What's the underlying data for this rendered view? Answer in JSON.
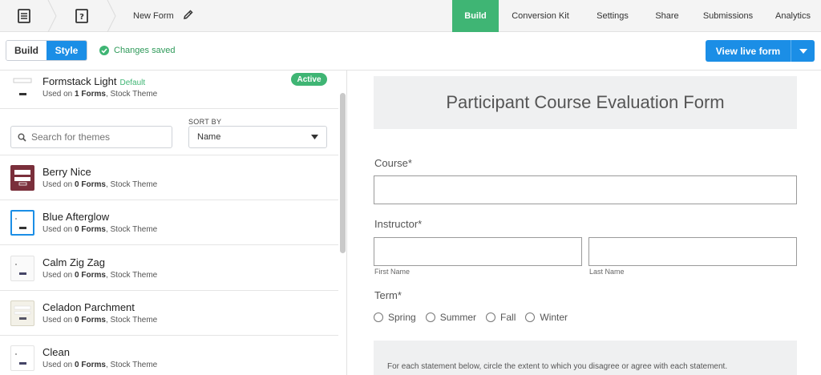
{
  "topbar": {
    "form_name": "New Form",
    "tabs": [
      {
        "label": "Build",
        "active": true
      },
      {
        "label": "Conversion Kit",
        "active": false
      },
      {
        "label": "Settings",
        "active": false
      },
      {
        "label": "Share",
        "active": false
      },
      {
        "label": "Submissions",
        "active": false
      },
      {
        "label": "Analytics",
        "active": false
      }
    ]
  },
  "subbar": {
    "toggle": {
      "build": "Build",
      "style": "Style",
      "selected": "Style"
    },
    "status": "Changes saved",
    "view_live": "View live form"
  },
  "themes_panel": {
    "current": {
      "name": "Formstack Light",
      "default_tag": "Default",
      "meta_prefix": "Used on ",
      "meta_count": "1 Forms",
      "meta_suffix": ", Stock Theme",
      "badge": "Active"
    },
    "search_placeholder": "Search for themes",
    "sort_by_label": "SORT BY",
    "sort_value": "Name",
    "items": [
      {
        "name": "Berry Nice",
        "meta_prefix": "Used on ",
        "meta_count": "0 Forms",
        "meta_suffix": ", Stock Theme"
      },
      {
        "name": "Blue Afterglow",
        "meta_prefix": "Used on ",
        "meta_count": "0 Forms",
        "meta_suffix": ", Stock Theme"
      },
      {
        "name": "Calm Zig Zag",
        "meta_prefix": "Used on ",
        "meta_count": "0 Forms",
        "meta_suffix": ", Stock Theme"
      },
      {
        "name": "Celadon Parchment",
        "meta_prefix": "Used on ",
        "meta_count": "0 Forms",
        "meta_suffix": ", Stock Theme"
      },
      {
        "name": "Clean",
        "meta_prefix": "Used on ",
        "meta_count": "0 Forms",
        "meta_suffix": ", Stock Theme"
      }
    ]
  },
  "form_preview": {
    "title": "Participant Course Evaluation Form",
    "course_label": "Course*",
    "instructor_label": "Instructor*",
    "first_name": "First Name",
    "last_name": "Last Name",
    "term_label": "Term*",
    "term_options": [
      "Spring",
      "Summer",
      "Fall",
      "Winter"
    ],
    "instructions": "For each statement below, circle the extent to which you disagree or agree with each statement."
  },
  "colors": {
    "accent_green": "#3fb574",
    "accent_blue": "#1b8ee6"
  }
}
